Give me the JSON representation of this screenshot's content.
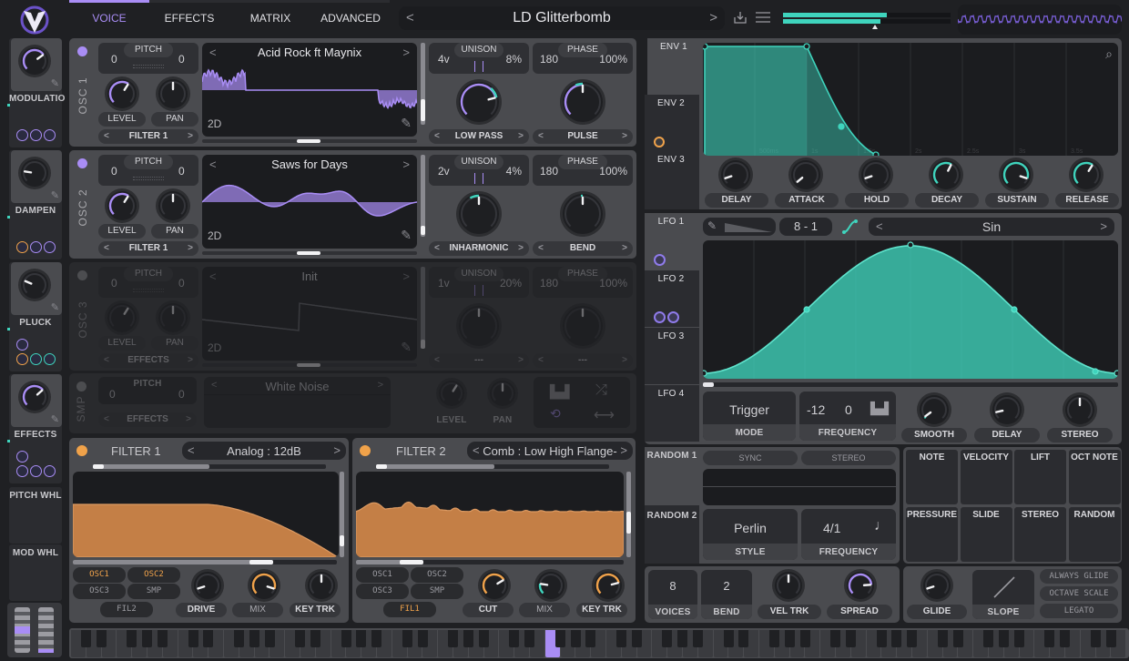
{
  "app": {
    "logo": "vital-logo",
    "accent": "#a98df5",
    "teal": "#3fd4bd",
    "orange": "#f0a24a"
  },
  "top_tabs": [
    {
      "label": "VOICE",
      "active": true
    },
    {
      "label": "EFFECTS",
      "active": false
    },
    {
      "label": "MATRIX",
      "active": false
    },
    {
      "label": "ADVANCED",
      "active": false
    }
  ],
  "preset": {
    "name": "LD Glitterbomb",
    "prev": "<",
    "next": ">",
    "save_icon": "save-icon",
    "menu_icon": "menu-icon"
  },
  "volume": {
    "left_level": 0.62,
    "right_level": 0.58,
    "threshold": 0.55
  },
  "sidebar": {
    "macros": [
      {
        "label": "MODULATIO",
        "value": 0.7
      },
      {
        "label": "DAMPEN",
        "value": 0.2
      },
      {
        "label": "PLUCK",
        "value": 0.25
      },
      {
        "label": "EFFECTS",
        "value": 0.68
      }
    ],
    "wheels": [
      {
        "label": "PITCH WHL"
      },
      {
        "label": "MOD WHL"
      }
    ]
  },
  "oscillators": [
    {
      "name": "OSC 1",
      "enabled": true,
      "pitch_label": "PITCH",
      "pitch_left": "0",
      "pitch_right": "0",
      "wavetable": "Acid Rock ft Maynix",
      "dim": "2D",
      "level_label": "LEVEL",
      "pan_label": "PAN",
      "destination": "FILTER 1",
      "unison_label": "UNISON",
      "unison_voices": "4v",
      "unison_detune": "8%",
      "phase_label": "PHASE",
      "phase_value": "180",
      "phase_rand": "100%",
      "spectral_mode": "LOW PASS",
      "distortion_mode": "PULSE"
    },
    {
      "name": "OSC 2",
      "enabled": true,
      "pitch_label": "PITCH",
      "pitch_left": "0",
      "pitch_right": "0",
      "wavetable": "Saws for Days",
      "dim": "2D",
      "level_label": "LEVEL",
      "pan_label": "PAN",
      "destination": "FILTER 1",
      "unison_label": "UNISON",
      "unison_voices": "2v",
      "unison_detune": "4%",
      "phase_label": "PHASE",
      "phase_value": "180",
      "phase_rand": "100%",
      "spectral_mode": "INHARMONIC",
      "distortion_mode": "BEND"
    },
    {
      "name": "OSC 3",
      "enabled": false,
      "pitch_label": "PITCH",
      "pitch_left": "0",
      "pitch_right": "0",
      "wavetable": "Init",
      "dim": "2D",
      "level_label": "LEVEL",
      "pan_label": "PAN",
      "destination": "EFFECTS",
      "unison_label": "UNISON",
      "unison_voices": "1v",
      "unison_detune": "20%",
      "phase_label": "PHASE",
      "phase_value": "180",
      "phase_rand": "100%",
      "spectral_mode": "---",
      "distortion_mode": "---"
    }
  ],
  "sampler": {
    "name": "SMP",
    "enabled": false,
    "pitch_label": "PITCH",
    "pitch_left": "0",
    "pitch_right": "0",
    "sample": "White Noise",
    "destination": "EFFECTS",
    "level_label": "LEVEL",
    "pan_label": "PAN"
  },
  "filters": [
    {
      "name": "FILTER 1",
      "enabled": true,
      "model": "Analog : 12dB",
      "sources": [
        {
          "label": "OSC1",
          "on": true
        },
        {
          "label": "OSC2",
          "on": true
        },
        {
          "label": "OSC3",
          "on": false
        },
        {
          "label": "SMP",
          "on": false
        }
      ],
      "chain": {
        "label": "FIL2",
        "on": false
      },
      "knobs": [
        "DRIVE",
        "MIX",
        "KEY TRK"
      ]
    },
    {
      "name": "FILTER 2",
      "enabled": true,
      "model": "Comb : Low High Flange-",
      "sources": [
        {
          "label": "OSC1",
          "on": false
        },
        {
          "label": "OSC2",
          "on": false
        },
        {
          "label": "OSC3",
          "on": false
        },
        {
          "label": "SMP",
          "on": false
        }
      ],
      "chain": {
        "label": "FIL1",
        "on": true
      },
      "knobs": [
        "CUT",
        "MIX",
        "KEY TRK"
      ]
    }
  ],
  "envelopes": {
    "tabs": [
      "ENV 1",
      "ENV 2",
      "ENV 3"
    ],
    "active": 0,
    "time_labels": [
      "500ms",
      "1s",
      "1.5s",
      "2s",
      "2.5s",
      "3s",
      "3.5s"
    ],
    "knobs": [
      "DELAY",
      "ATTACK",
      "HOLD",
      "DECAY",
      "SUSTAIN",
      "RELEASE"
    ]
  },
  "lfos": {
    "tabs": [
      "LFO 1",
      "LFO 2",
      "LFO 3",
      "LFO 4"
    ],
    "active": 0,
    "grid": "8 - 1",
    "shape": "Sin",
    "mode_value": "Trigger",
    "mode_label": "MODE",
    "freq_value1": "-12",
    "freq_value2": "0",
    "freq_label": "FREQUENCY",
    "knobs": [
      "SMOOTH",
      "DELAY",
      "STEREO"
    ]
  },
  "randoms": {
    "tabs": [
      "RANDOM 1",
      "RANDOM 2"
    ],
    "sync_label": "SYNC",
    "stereo_label": "STEREO",
    "style_value": "Perlin",
    "style_label": "STYLE",
    "freq_value": "4/1",
    "freq_label": "FREQUENCY"
  },
  "mod_sources": [
    "NOTE",
    "VELOCITY",
    "LIFT",
    "OCT NOTE",
    "PRESSURE",
    "SLIDE",
    "STEREO",
    "RANDOM"
  ],
  "voice": {
    "voices": "8",
    "voices_label": "VOICES",
    "bend": "2",
    "bend_label": "BEND",
    "vel_trk_label": "VEL TRK",
    "spread_label": "SPREAD"
  },
  "glide": {
    "glide_label": "GLIDE",
    "slope_label": "SLOPE",
    "always_glide": "ALWAYS GLIDE",
    "octave_scale": "OCTAVE SCALE",
    "legato": "LEGATO"
  }
}
